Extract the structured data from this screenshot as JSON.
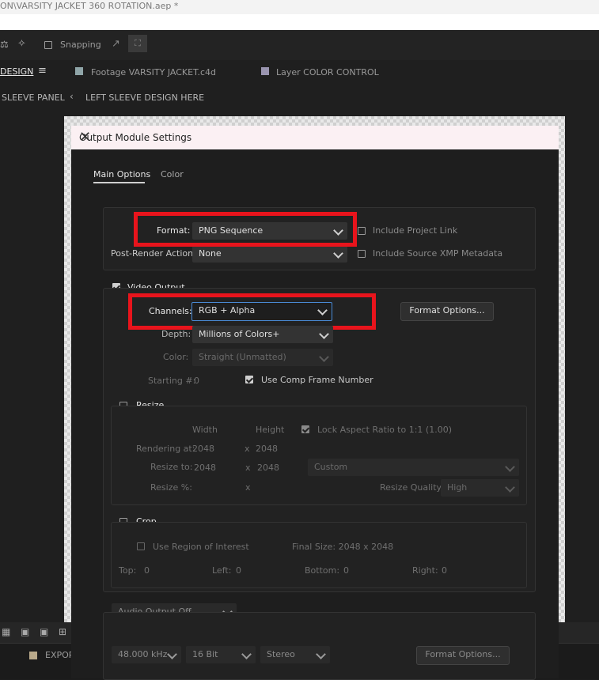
{
  "window": {
    "title": "ON\\VARSITY JACKET 360 ROTATION.aep *"
  },
  "toolbar": {
    "snapping_label": "Snapping"
  },
  "tabs": [
    {
      "label": "DESIGN"
    },
    {
      "label": "Footage VARSITY JACKET.c4d"
    },
    {
      "label": "Layer COLOR CONTROL"
    }
  ],
  "breadcrumb": {
    "left": "SLEEVE PANEL",
    "right": "LEFT SLEEVE DESIGN HERE"
  },
  "dialog": {
    "title": "Output Module Settings",
    "tabs": [
      {
        "label": "Main Options"
      },
      {
        "label": "Color"
      }
    ],
    "format": {
      "label": "Format:",
      "value": "PNG Sequence",
      "include_project_link": "Include Project Link",
      "post_render_label": "Post-Render Action:",
      "post_render_value": "None",
      "include_xmp": "Include Source XMP Metadata"
    },
    "video": {
      "label": "Video Output",
      "channels_label": "Channels:",
      "channels_value": "RGB + Alpha",
      "format_options": "Format Options...",
      "depth_label": "Depth:",
      "depth_value": "Millions of Colors+",
      "color_label": "Color:",
      "color_value": "Straight (Unmatted)",
      "starting_label": "Starting #:",
      "starting_value": "0",
      "use_comp_frame": "Use Comp Frame Number"
    },
    "resize": {
      "label": "Resize",
      "width_header": "Width",
      "height_header": "Height",
      "lock_aspect": "Lock Aspect Ratio to 1:1 (1.00)",
      "rendering_at_label": "Rendering at:",
      "rendering_w": "2048",
      "rendering_h": "2048",
      "resize_to_label": "Resize to:",
      "resize_to_w": "2048",
      "resize_to_h": "2048",
      "resize_preset": "Custom",
      "resize_pct_label": "Resize %:",
      "x": "x",
      "quality_label": "Resize Quality:",
      "quality_value": "High"
    },
    "crop": {
      "label": "Crop",
      "use_roi": "Use Region of Interest",
      "final_size": "Final Size: 2048 x 2048",
      "top_label": "Top:",
      "top_value": "0",
      "left_label": "Left:",
      "left_value": "0",
      "bottom_label": "Bottom:",
      "bottom_value": "0",
      "right_label": "Right:",
      "right_value": "0"
    },
    "audio": {
      "output": "Audio Output Off",
      "rate": "48.000 kHz",
      "bits": "16 Bit",
      "channels": "Stereo",
      "format_options": "Format Options..."
    }
  },
  "bottom": {
    "export_label": "EXPOR"
  },
  "colors": {
    "highlight_red": "#e8141c",
    "focus_blue": "#4a8bd6"
  }
}
